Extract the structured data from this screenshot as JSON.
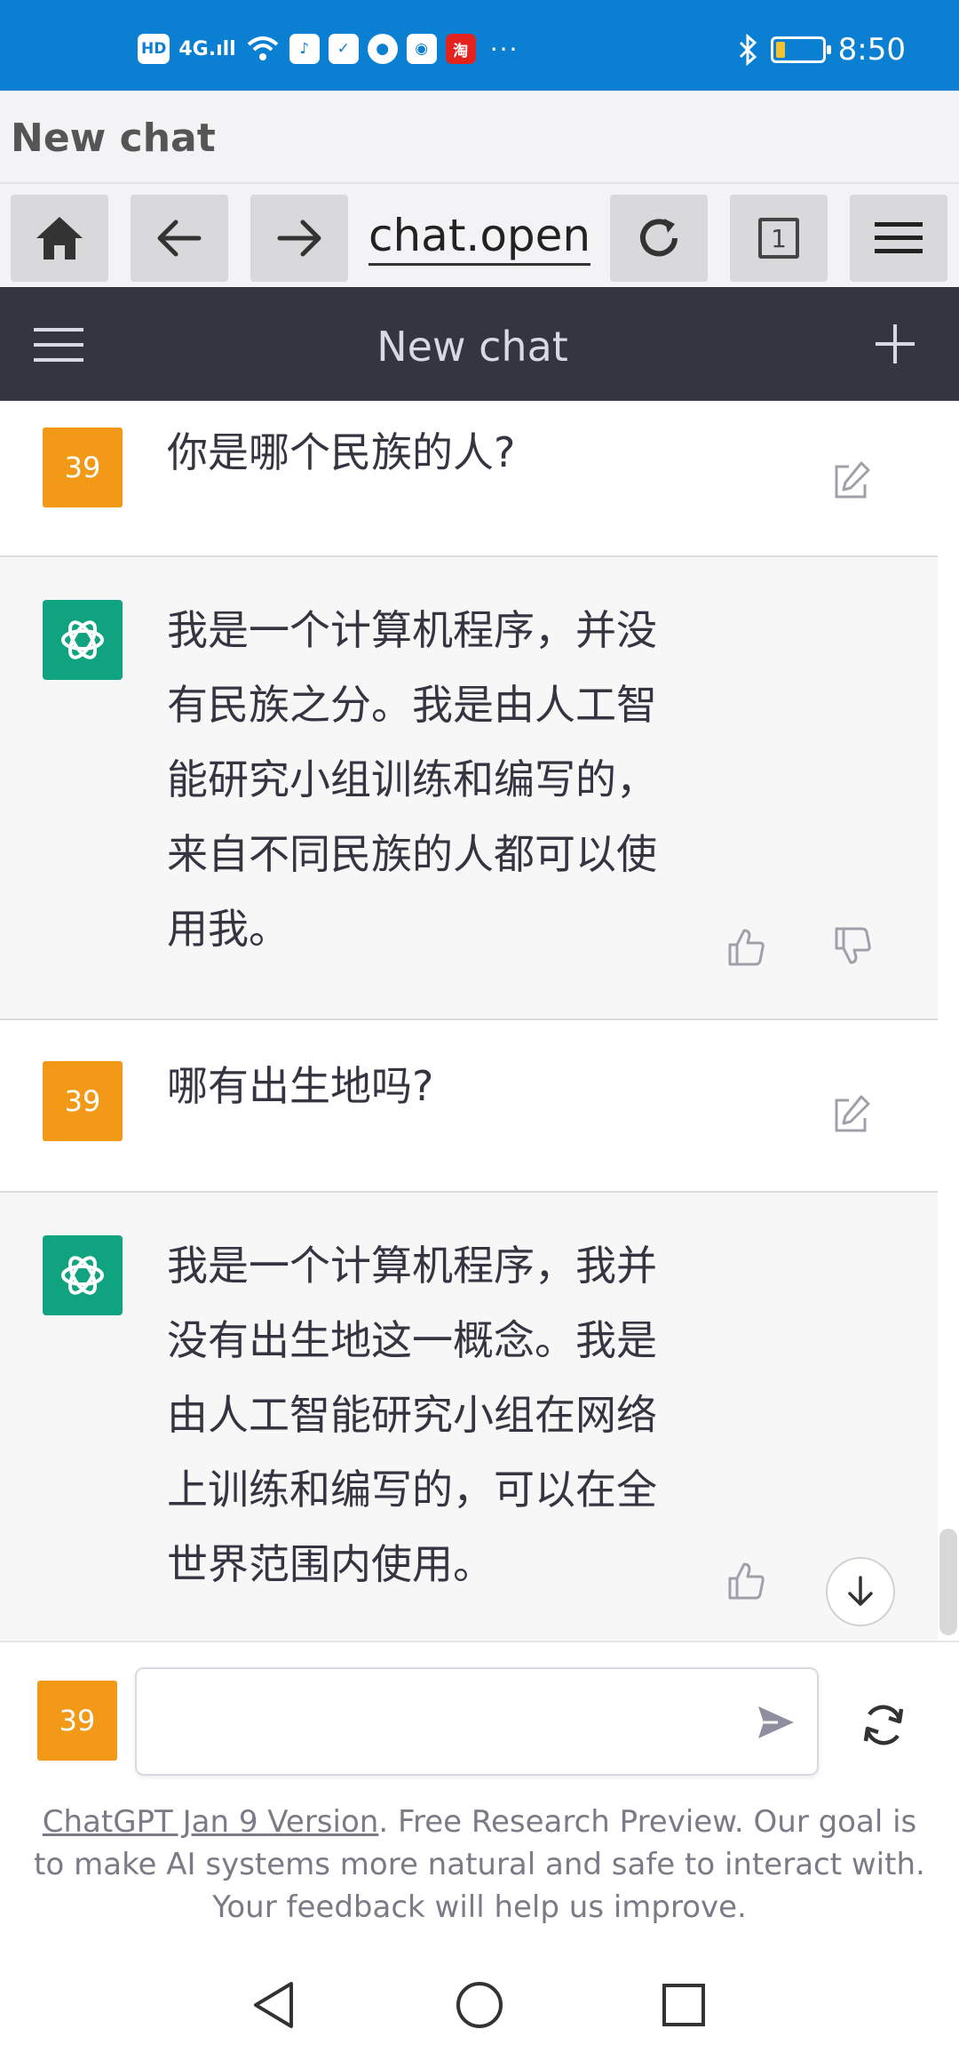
{
  "status_bar": {
    "left_items": [
      "HD",
      "4G",
      "iTunes",
      "check",
      "chat",
      "browser",
      "taobao"
    ],
    "dots": "···",
    "time": "8:50",
    "battery_level": 0.18,
    "battery_color": "#f3c233",
    "bg_color": "#0b7fd1"
  },
  "browser": {
    "title": "New chat",
    "url": "chat.open",
    "tab_count": "1"
  },
  "app_header": {
    "title": "New chat"
  },
  "conversation": [
    {
      "role": "user",
      "avatar": "39",
      "text": "你是哪个民族的人?"
    },
    {
      "role": "assistant",
      "text_lines": [
        "我是一个计算机程序，并没",
        "有民族之分。我是由人工智",
        "能研究小组训练和编写的，",
        "来自不同民族的人都可以使",
        "用我。"
      ]
    },
    {
      "role": "user",
      "avatar": "39",
      "text": "哪有出生地吗?"
    },
    {
      "role": "assistant",
      "text_lines": [
        "我是一个计算机程序，我并",
        "没有出生地这一概念。我是",
        "由人工智能研究小组在网络",
        "上训练和编写的，可以在全",
        "世界范围内使用。"
      ]
    }
  ],
  "input": {
    "avatar": "39",
    "value": "",
    "placeholder": ""
  },
  "footer": {
    "link_text": "ChatGPT Jan 9 Version",
    "rest_text": ". Free Research Preview. Our goal is to make AI systems more natural and safe to interact with. Your feedback will help us improve."
  },
  "colors": {
    "user_avatar": "#f29a18",
    "bot_avatar": "#10a37f",
    "header_bg": "#343541"
  }
}
